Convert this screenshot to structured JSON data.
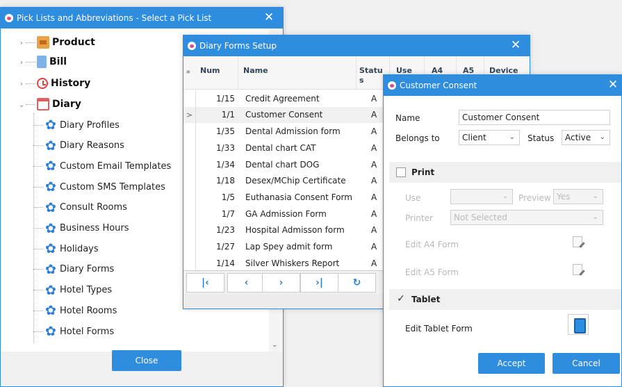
{
  "pick_window": {
    "title": "Pick Lists and Abbreviations - Select a Pick List",
    "close_glyph": "✕",
    "tree": [
      {
        "label": "Product",
        "icon": "product-icon",
        "expander": "›"
      },
      {
        "label": "Bill",
        "icon": "bill-icon",
        "expander": "›"
      },
      {
        "label": "History",
        "icon": "history-icon",
        "expander": "›"
      },
      {
        "label": "Diary",
        "icon": "calendar-icon",
        "expander": "⌄"
      }
    ],
    "diary_children": [
      "Diary Profiles",
      "Diary Reasons",
      "Custom Email Templates",
      "Custom SMS Templates",
      "Consult Rooms",
      "Business Hours",
      "Holidays",
      "Diary Forms",
      "Hotel Types",
      "Hotel Rooms",
      "Hotel Forms"
    ],
    "child_icon": "gear-icon",
    "close_button": "Close"
  },
  "diary_forms_window": {
    "title": "Diary Forms Setup",
    "close_glyph": "✕",
    "columns": {
      "indicator": "*",
      "num": "Num",
      "name": "Name",
      "status": "Statu s",
      "use": "Use",
      "a4": "A4",
      "a5": "A5",
      "device": "Device"
    },
    "rows": [
      {
        "num": "1/15",
        "name": "Credit Agreement",
        "status": "A",
        "indicator": ""
      },
      {
        "num": "1/1",
        "name": "Customer Consent",
        "status": "A",
        "indicator": ">"
      },
      {
        "num": "1/35",
        "name": "Dental Admission form",
        "status": "A",
        "indicator": ""
      },
      {
        "num": "1/33",
        "name": "Dental chart CAT",
        "status": "A",
        "indicator": ""
      },
      {
        "num": "1/34",
        "name": "Dental chart DOG",
        "status": "A",
        "indicator": ""
      },
      {
        "num": "1/18",
        "name": "Desex/MChip Certificate",
        "status": "A",
        "indicator": ""
      },
      {
        "num": "1/5",
        "name": "Euthanasia Consent Form",
        "status": "A",
        "indicator": ""
      },
      {
        "num": "1/7",
        "name": "GA Admission Form",
        "status": "A",
        "indicator": ""
      },
      {
        "num": "1/23",
        "name": "Hospital Admisson form",
        "status": "A",
        "indicator": ""
      },
      {
        "num": "1/27",
        "name": "Lap Spey admit form",
        "status": "A",
        "indicator": ""
      },
      {
        "num": "1/14",
        "name": "Silver Whiskers Report",
        "status": "A",
        "indicator": ""
      }
    ],
    "nav": {
      "first": "|‹",
      "prev": "‹",
      "next": "›",
      "last": "›|",
      "refresh": "↻"
    }
  },
  "consent_window": {
    "title": "Customer Consent",
    "close_glyph": "✕",
    "name_label": "Name",
    "name_value": "Customer Consent",
    "belongs_label": "Belongs to",
    "belongs_value": "Client",
    "status_label": "Status",
    "status_value": "Active",
    "print_section": "Print",
    "use_label": "Use",
    "use_value": "",
    "preview_label": "Preview",
    "preview_value": "Yes",
    "printer_label": "Printer",
    "printer_value": "Not Selected",
    "edit_a4_label": "Edit A4 Form",
    "edit_a5_label": "Edit A5 Form",
    "tablet_section": "Tablet",
    "tablet_checked": "✓",
    "edit_tablet_label": "Edit Tablet Form",
    "accept_button": "Accept",
    "cancel_button": "Cancel",
    "dropdown_glyph": "⌄"
  }
}
